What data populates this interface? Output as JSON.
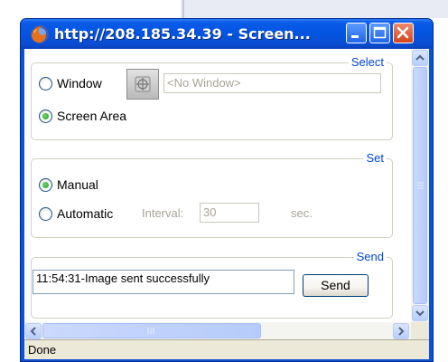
{
  "window": {
    "title": "http://208.185.34.39 - Screen..."
  },
  "select_group": {
    "legend": "Select",
    "window_option": {
      "label": "Window",
      "checked": false
    },
    "window_field_value": "<No Window>",
    "screen_area_option": {
      "label": "Screen Area",
      "checked": true
    }
  },
  "set_group": {
    "legend": "Set",
    "manual_option": {
      "label": "Manual",
      "checked": true
    },
    "automatic_option": {
      "label": "Automatic",
      "checked": false
    },
    "interval_label": "Interval:",
    "interval_value": "30",
    "unit_label": "sec."
  },
  "send_group": {
    "legend": "Send",
    "message": "11:54:31-Image sent successfully",
    "send_label": "Send"
  },
  "status_bar": {
    "text": "Done"
  },
  "colors": {
    "titlebar": "#0355e0",
    "legend_text": "#0046d5",
    "radio_checked": "#21a121"
  }
}
